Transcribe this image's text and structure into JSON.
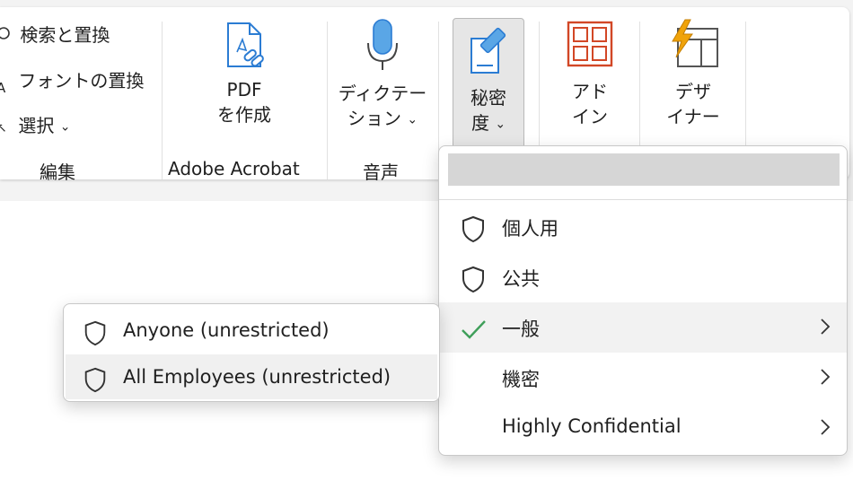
{
  "ribbon": {
    "edit_group": {
      "find_replace": "検索と置換",
      "font_replace": "フォントの置換",
      "select": "選択",
      "label": "編集"
    },
    "acrobat_group": {
      "create_pdf_line1": "PDF",
      "create_pdf_line2": "を作成",
      "label": "Adobe Acrobat"
    },
    "voice_group": {
      "dictation_line1": "ディクテー",
      "dictation_line2": "ション",
      "label": "音声"
    },
    "sensitivity": {
      "line1": "秘密",
      "line2": "度"
    },
    "addins": {
      "line1": "アド",
      "line2": "イン"
    },
    "designer": {
      "line1": "デザ",
      "line2": "イナー"
    }
  },
  "sensitivity_menu": {
    "items": [
      {
        "label": "個人用",
        "icon": "shield-icon",
        "has_submenu": false,
        "checked": false
      },
      {
        "label": "公共",
        "icon": "shield-icon",
        "has_submenu": false,
        "checked": false
      },
      {
        "label": "一般",
        "icon": "checkmark-icon",
        "has_submenu": true,
        "checked": true
      },
      {
        "label": "機密",
        "icon": "",
        "has_submenu": true,
        "checked": false
      },
      {
        "label": "Highly Confidential",
        "icon": "",
        "has_submenu": true,
        "checked": false
      }
    ]
  },
  "general_submenu": {
    "items": [
      {
        "label": "Anyone (unrestricted)",
        "icon": "shield-icon"
      },
      {
        "label": "All Employees (unrestricted)",
        "icon": "shield-icon"
      }
    ]
  },
  "colors": {
    "accent_blue": "#2b7cd3",
    "addin_red": "#d24726",
    "designer_orange": "#f0a30a",
    "check_green": "#3f9f5a"
  }
}
